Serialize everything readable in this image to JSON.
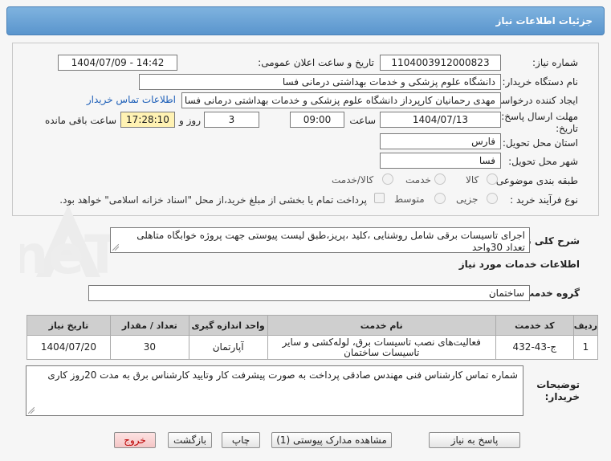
{
  "header": {
    "title": "جزئیات اطلاعات نیاز"
  },
  "form": {
    "need_number": {
      "label": "شماره نیاز:",
      "value": "1104003912000823"
    },
    "announce_datetime": {
      "label": "تاریخ و ساعت اعلان عمومی:",
      "value": "1404/07/09 - 14:42"
    },
    "buyer_org": {
      "label": "نام دستگاه خریدار:",
      "value": "دانشگاه علوم پزشکی و خدمات بهداشتی درمانی فسا"
    },
    "requester": {
      "label": "ایجاد کننده درخواست:",
      "value": "مهدی رحمانیان کارپرداز دانشگاه علوم پزشکی و خدمات بهداشتی درمانی فسا",
      "contact_link": "اطلاعات تماس خریدار"
    },
    "deadline": {
      "label_line1": "مهلت ارسال پاسخ: تا",
      "label_line2": "تاریخ:",
      "date": "1404/07/13",
      "time_label": "ساعت",
      "time": "09:00",
      "days": "3",
      "days_label": "روز و",
      "remaining": "17:28:10",
      "remaining_label": "ساعت باقی مانده"
    },
    "province": {
      "label": "استان محل تحویل:",
      "value": "فارس"
    },
    "city": {
      "label": "شهر محل تحویل:",
      "value": "فسا"
    },
    "category": {
      "label": "طبقه بندی موضوعی:",
      "options": [
        "کالا",
        "خدمت",
        "کالا/خدمت"
      ]
    },
    "process_type": {
      "label": "نوع فرآیند خرید :",
      "options": [
        "جزیی",
        "متوسط"
      ],
      "payment_note": "پرداخت تمام یا بخشی از مبلغ خرید،از محل \"اسناد خزانه اسلامی\" خواهد بود."
    }
  },
  "description": {
    "label": "شرح کلی نیاز:",
    "text": "اجرای تاسیسات برقی شامل روشنایی ،کلید ،پریز،طبق لیست پیوستی جهت پروژه خوابگاه متاهلی تعداد 30واحد"
  },
  "services": {
    "section_title": "اطلاعات خدمات مورد نیاز",
    "group_label": "گروه خدمت:",
    "group_value": "ساختمان",
    "columns": [
      "ردیف",
      "کد خدمت",
      "نام خدمت",
      "واحد اندازه گیری",
      "تعداد / مقدار",
      "تاریخ نیاز"
    ],
    "rows": [
      {
        "index": "1",
        "code": "ج-43-432",
        "name": "فعالیت‌های نصب تاسیسات برق، لوله‌کشی و سایر تاسیسات ساختمان",
        "unit": "آپارتمان",
        "qty": "30",
        "date": "1404/07/20"
      }
    ]
  },
  "buyer_notes": {
    "label_line1": "توضیحات",
    "label_line2": "خریدار:",
    "text": "شماره تماس کارشناس فنی مهندس صادقی پرداخت به صورت پیشرفت کار وتایید کارشناس برق به مدت 20روز کاری"
  },
  "buttons": {
    "reply": "پاسخ به نیاز",
    "attachments": "مشاهده مدارک پیوستی (1)",
    "print": "چاپ",
    "back": "بازگشت",
    "exit": "خروج"
  },
  "watermark": {
    "text": "AriaTender.neT"
  },
  "colors": {
    "header": "#5a95cd",
    "link": "#1d5fb8",
    "remaining_bg": "#fff2b3",
    "table_header": "#cfcfcf",
    "exit_text": "#b00000"
  }
}
